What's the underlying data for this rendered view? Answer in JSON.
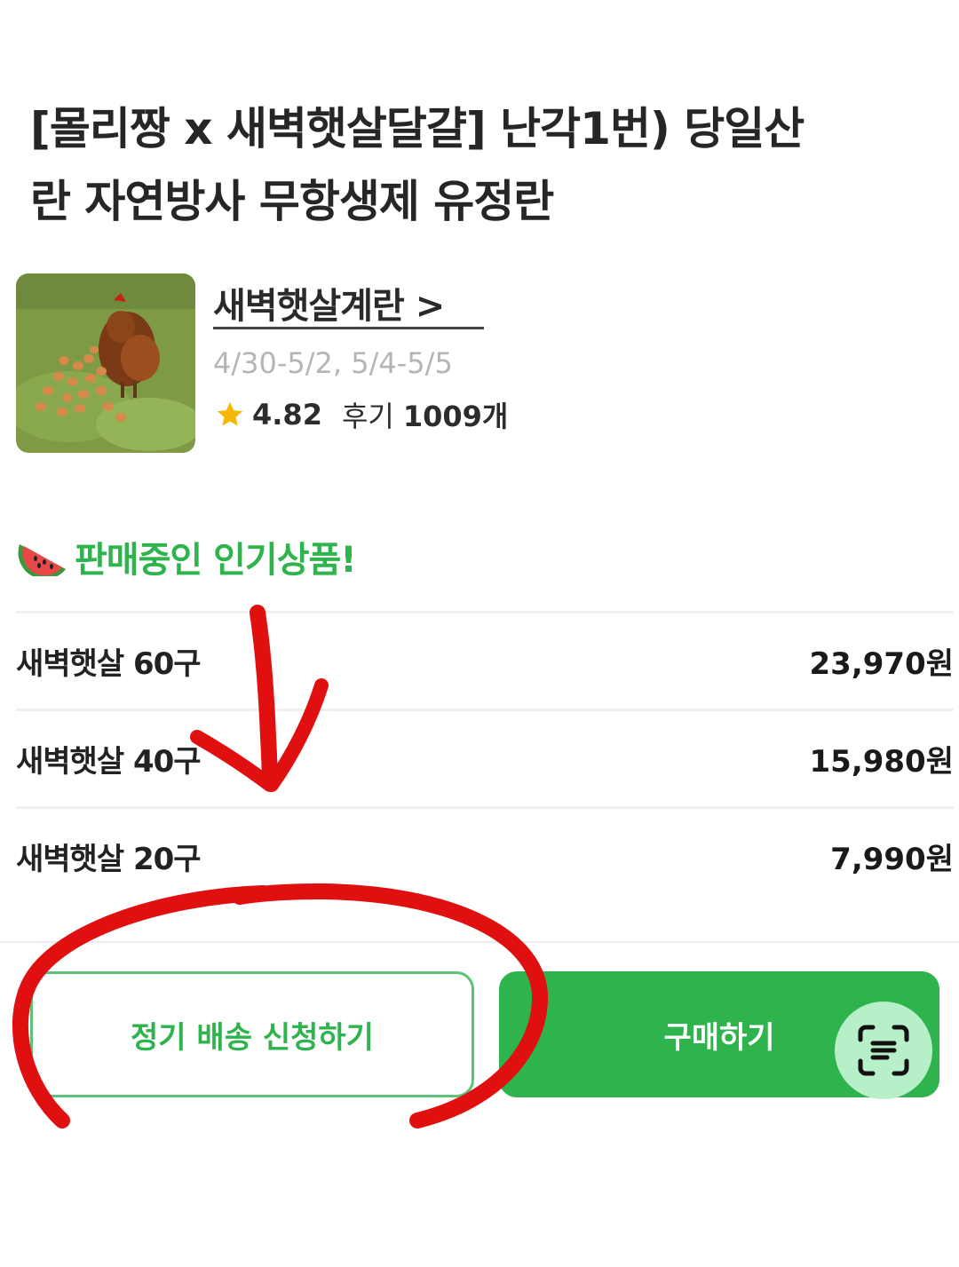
{
  "product": {
    "title_line1": "[몰리짱 x 새벽햇살달걀] 난각1번) 당일산",
    "title_line2": "란 자연방사 무항생제 유정란"
  },
  "store": {
    "name": "새벽햇살계란 >",
    "dates": "4/30-5/2, 5/4-5/5",
    "rating": "4.82",
    "review_label": "후기",
    "review_count": "1009개"
  },
  "popular": {
    "title": "판매중인 인기상품!",
    "items": [
      {
        "name": "새벽햇살 60구",
        "price": "23,970원"
      },
      {
        "name": "새벽햇살 40구",
        "price": "15,980원"
      },
      {
        "name": "새벽햇살 20구",
        "price": "7,990원"
      }
    ]
  },
  "actions": {
    "subscribe_label": "정기 배송 신청하기",
    "buy_label": "구매하기"
  },
  "colors": {
    "accent_green": "#2fb34c",
    "annotation_red": "#e01010"
  },
  "icons": {
    "star": "star-icon",
    "watermelon": "watermelon-icon",
    "scan": "text-scan-icon"
  }
}
